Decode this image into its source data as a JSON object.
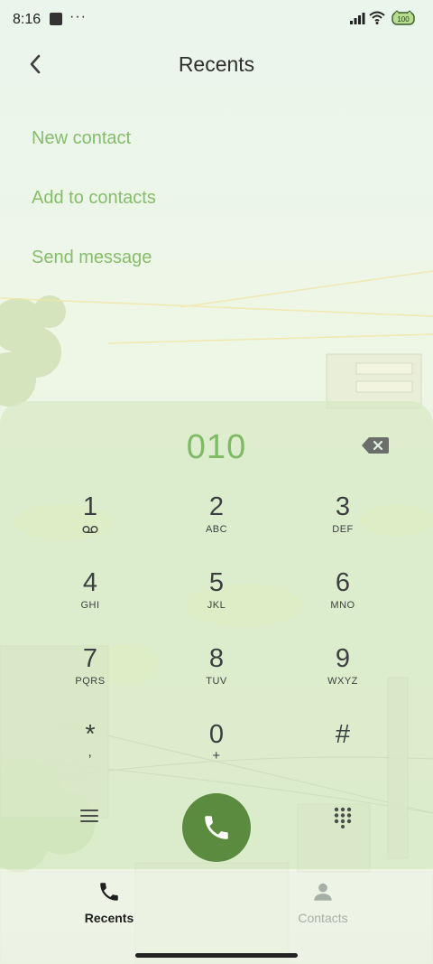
{
  "status": {
    "time": "8:16",
    "dots": "···",
    "battery": "100"
  },
  "header": {
    "title": "Recents"
  },
  "menu": {
    "new_contact": "New contact",
    "add_to_contacts": "Add to contacts",
    "send_message": "Send message"
  },
  "dialer": {
    "number": "010",
    "keys": [
      {
        "digit": "1",
        "letters": ""
      },
      {
        "digit": "2",
        "letters": "ABC"
      },
      {
        "digit": "3",
        "letters": "DEF"
      },
      {
        "digit": "4",
        "letters": "GHI"
      },
      {
        "digit": "5",
        "letters": "JKL"
      },
      {
        "digit": "6",
        "letters": "MNO"
      },
      {
        "digit": "7",
        "letters": "PQRS"
      },
      {
        "digit": "8",
        "letters": "TUV"
      },
      {
        "digit": "9",
        "letters": "WXYZ"
      },
      {
        "digit": "*",
        "letters": ","
      },
      {
        "digit": "0",
        "letters": "+"
      },
      {
        "digit": "#",
        "letters": ""
      }
    ]
  },
  "tabs": {
    "recents": "Recents",
    "contacts": "Contacts"
  },
  "colors": {
    "accent": "#7fba66",
    "call_button": "#5a8b3f"
  }
}
